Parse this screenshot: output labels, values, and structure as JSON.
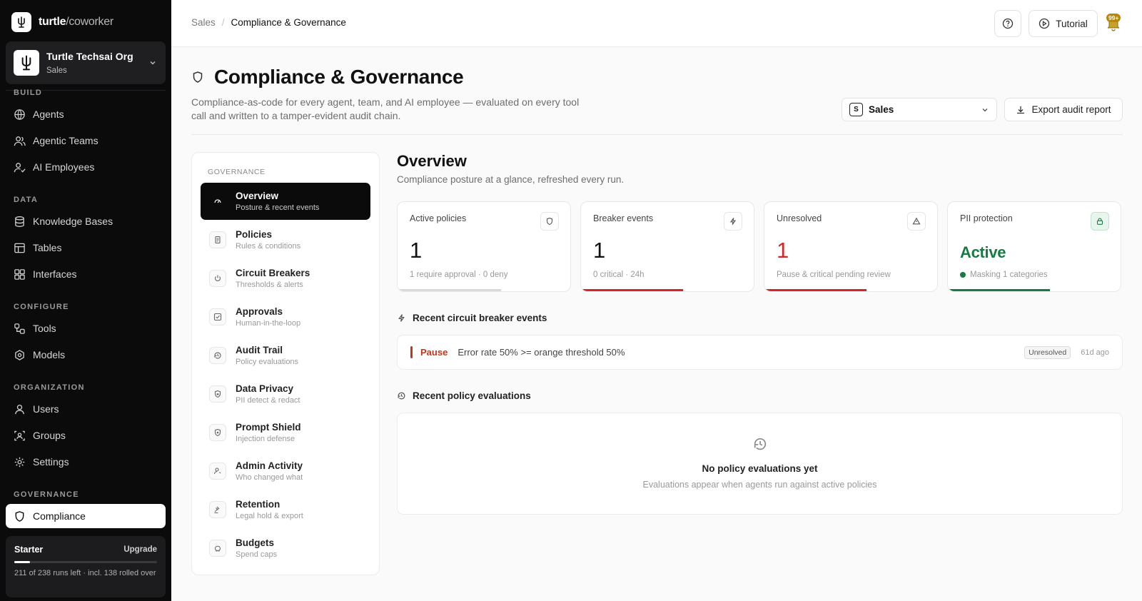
{
  "brand": {
    "name": "turtle",
    "suffix": "/coworker"
  },
  "org": {
    "name": "Turtle Techsai Org",
    "team": "Sales"
  },
  "sidebar": {
    "sections": {
      "build": "BUILD",
      "data": "DATA",
      "configure": "CONFIGURE",
      "organization": "ORGANIZATION",
      "governance": "GOVERNANCE"
    },
    "items": {
      "agents": "Agents",
      "agentic_teams": "Agentic Teams",
      "ai_employees": "AI Employees",
      "knowledge_bases": "Knowledge Bases",
      "tables": "Tables",
      "interfaces": "Interfaces",
      "tools": "Tools",
      "models": "Models",
      "users": "Users",
      "groups": "Groups",
      "settings": "Settings",
      "compliance": "Compliance"
    }
  },
  "plan": {
    "name": "Starter",
    "upgrade": "Upgrade",
    "usage_text": "211 of 238 runs left · incl. 138 rolled over",
    "used_fraction": 0.11
  },
  "topbar": {
    "breadcrumb": [
      "Sales",
      "Compliance & Governance"
    ],
    "tutorial": "Tutorial",
    "notif_badge": "99+"
  },
  "header": {
    "title": "Compliance & Governance",
    "description": "Compliance-as-code for every agent, team, and AI employee — evaluated on every tool call and written to a tamper-evident audit chain.",
    "team_badge": "S",
    "team_select": "Sales",
    "export": "Export audit report"
  },
  "gov_nav": {
    "label": "GOVERNANCE",
    "items": [
      {
        "title": "Overview",
        "sub": "Posture & recent events"
      },
      {
        "title": "Policies",
        "sub": "Rules & conditions"
      },
      {
        "title": "Circuit Breakers",
        "sub": "Thresholds & alerts"
      },
      {
        "title": "Approvals",
        "sub": "Human-in-the-loop"
      },
      {
        "title": "Audit Trail",
        "sub": "Policy evaluations"
      },
      {
        "title": "Data Privacy",
        "sub": "PII detect & redact"
      },
      {
        "title": "Prompt Shield",
        "sub": "Injection defense"
      },
      {
        "title": "Admin Activity",
        "sub": "Who changed what"
      },
      {
        "title": "Retention",
        "sub": "Legal hold & export"
      },
      {
        "title": "Budgets",
        "sub": "Spend caps"
      }
    ]
  },
  "overview": {
    "title": "Overview",
    "subtitle": "Compliance posture at a glance, refreshed every run.",
    "stats": [
      {
        "label": "Active policies",
        "value": "1",
        "note": "1 require approval · 0 deny",
        "bar_color": "#d9d9d9",
        "bar_fraction": 0.6
      },
      {
        "label": "Breaker events",
        "value": "1",
        "note": "0 critical · 24h",
        "bar_color": "#d3262c",
        "bar_fraction": 0.59
      },
      {
        "label": "Unresolved",
        "value": "1",
        "note": "Pause & critical pending review",
        "bar_color": "#d3262c",
        "bar_fraction": 0.59
      },
      {
        "label": "PII protection",
        "value": "Active",
        "note": "Masking 1 categories",
        "bar_color": "#177a43",
        "bar_fraction": 0.59
      }
    ],
    "breaker_section": "Recent circuit breaker events",
    "events": [
      {
        "kind": "Pause",
        "text": "Error rate 50% >= orange threshold 50%",
        "status": "Unresolved",
        "time": "61d ago"
      }
    ],
    "policy_section": "Recent policy evaluations",
    "empty_title": "No policy evaluations yet",
    "empty_sub": "Evaluations appear when agents run against active policies"
  }
}
